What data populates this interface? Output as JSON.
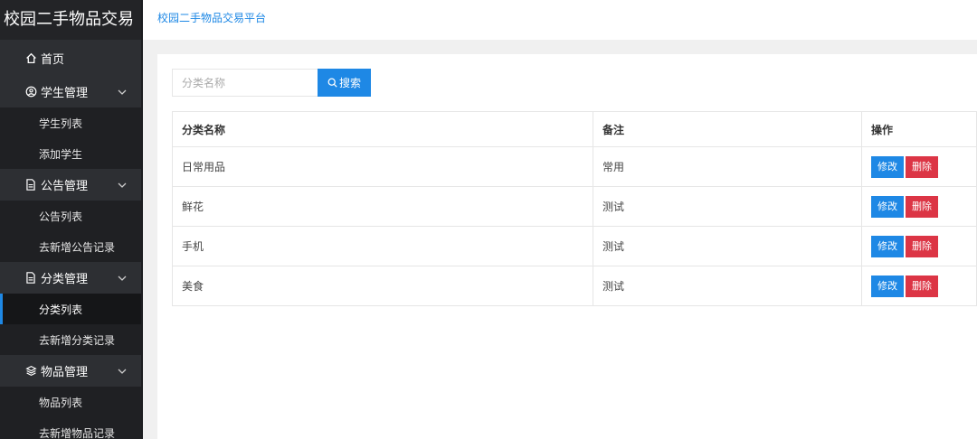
{
  "brand": "校园二手物品交易",
  "header_title": "校园二手物品交易平台",
  "nav": {
    "home": "首页",
    "groups": [
      {
        "label": "学生管理",
        "icon": "user-icon",
        "items": [
          "学生列表",
          "添加学生"
        ]
      },
      {
        "label": "公告管理",
        "icon": "document-icon",
        "items": [
          "公告列表",
          "去新增公告记录"
        ]
      },
      {
        "label": "分类管理",
        "icon": "document-icon",
        "items": [
          "分类列表",
          "去新增分类记录"
        ]
      },
      {
        "label": "物品管理",
        "icon": "layers-icon",
        "items": [
          "物品列表",
          "去新增物品记录"
        ]
      }
    ],
    "active_item": "分类列表"
  },
  "search": {
    "placeholder": "分类名称",
    "value": "",
    "button": "搜索"
  },
  "table": {
    "headers": [
      "分类名称",
      "备注",
      "操作"
    ],
    "rows": [
      {
        "name": "日常用品",
        "remark": "常用"
      },
      {
        "name": "鲜花",
        "remark": "测试"
      },
      {
        "name": "手机",
        "remark": "测试"
      },
      {
        "name": "美食",
        "remark": "测试"
      }
    ],
    "edit_label": "修改",
    "delete_label": "删除"
  },
  "colors": {
    "accent": "#1e88e5",
    "danger": "#dc3545",
    "sidebar": "#2d2f33",
    "sidebar_sub": "#1f2023"
  }
}
